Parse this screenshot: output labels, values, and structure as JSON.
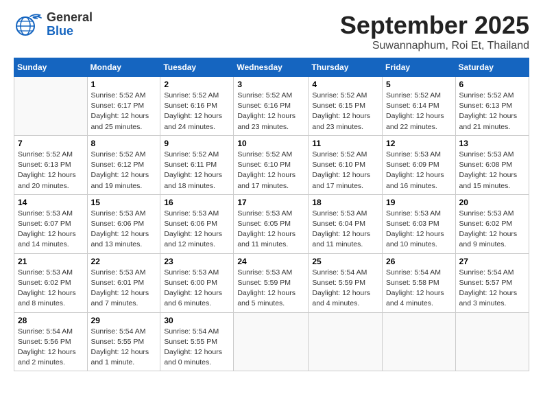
{
  "header": {
    "logo_line1": "General",
    "logo_line2": "Blue",
    "month": "September 2025",
    "location": "Suwannaphum, Roi Et, Thailand"
  },
  "weekdays": [
    "Sunday",
    "Monday",
    "Tuesday",
    "Wednesday",
    "Thursday",
    "Friday",
    "Saturday"
  ],
  "weeks": [
    [
      {
        "day": "",
        "info": ""
      },
      {
        "day": "1",
        "info": "Sunrise: 5:52 AM\nSunset: 6:17 PM\nDaylight: 12 hours\nand 25 minutes."
      },
      {
        "day": "2",
        "info": "Sunrise: 5:52 AM\nSunset: 6:16 PM\nDaylight: 12 hours\nand 24 minutes."
      },
      {
        "day": "3",
        "info": "Sunrise: 5:52 AM\nSunset: 6:16 PM\nDaylight: 12 hours\nand 23 minutes."
      },
      {
        "day": "4",
        "info": "Sunrise: 5:52 AM\nSunset: 6:15 PM\nDaylight: 12 hours\nand 23 minutes."
      },
      {
        "day": "5",
        "info": "Sunrise: 5:52 AM\nSunset: 6:14 PM\nDaylight: 12 hours\nand 22 minutes."
      },
      {
        "day": "6",
        "info": "Sunrise: 5:52 AM\nSunset: 6:13 PM\nDaylight: 12 hours\nand 21 minutes."
      }
    ],
    [
      {
        "day": "7",
        "info": "Sunrise: 5:52 AM\nSunset: 6:13 PM\nDaylight: 12 hours\nand 20 minutes."
      },
      {
        "day": "8",
        "info": "Sunrise: 5:52 AM\nSunset: 6:12 PM\nDaylight: 12 hours\nand 19 minutes."
      },
      {
        "day": "9",
        "info": "Sunrise: 5:52 AM\nSunset: 6:11 PM\nDaylight: 12 hours\nand 18 minutes."
      },
      {
        "day": "10",
        "info": "Sunrise: 5:52 AM\nSunset: 6:10 PM\nDaylight: 12 hours\nand 17 minutes."
      },
      {
        "day": "11",
        "info": "Sunrise: 5:52 AM\nSunset: 6:10 PM\nDaylight: 12 hours\nand 17 minutes."
      },
      {
        "day": "12",
        "info": "Sunrise: 5:53 AM\nSunset: 6:09 PM\nDaylight: 12 hours\nand 16 minutes."
      },
      {
        "day": "13",
        "info": "Sunrise: 5:53 AM\nSunset: 6:08 PM\nDaylight: 12 hours\nand 15 minutes."
      }
    ],
    [
      {
        "day": "14",
        "info": "Sunrise: 5:53 AM\nSunset: 6:07 PM\nDaylight: 12 hours\nand 14 minutes."
      },
      {
        "day": "15",
        "info": "Sunrise: 5:53 AM\nSunset: 6:06 PM\nDaylight: 12 hours\nand 13 minutes."
      },
      {
        "day": "16",
        "info": "Sunrise: 5:53 AM\nSunset: 6:06 PM\nDaylight: 12 hours\nand 12 minutes."
      },
      {
        "day": "17",
        "info": "Sunrise: 5:53 AM\nSunset: 6:05 PM\nDaylight: 12 hours\nand 11 minutes."
      },
      {
        "day": "18",
        "info": "Sunrise: 5:53 AM\nSunset: 6:04 PM\nDaylight: 12 hours\nand 11 minutes."
      },
      {
        "day": "19",
        "info": "Sunrise: 5:53 AM\nSunset: 6:03 PM\nDaylight: 12 hours\nand 10 minutes."
      },
      {
        "day": "20",
        "info": "Sunrise: 5:53 AM\nSunset: 6:02 PM\nDaylight: 12 hours\nand 9 minutes."
      }
    ],
    [
      {
        "day": "21",
        "info": "Sunrise: 5:53 AM\nSunset: 6:02 PM\nDaylight: 12 hours\nand 8 minutes."
      },
      {
        "day": "22",
        "info": "Sunrise: 5:53 AM\nSunset: 6:01 PM\nDaylight: 12 hours\nand 7 minutes."
      },
      {
        "day": "23",
        "info": "Sunrise: 5:53 AM\nSunset: 6:00 PM\nDaylight: 12 hours\nand 6 minutes."
      },
      {
        "day": "24",
        "info": "Sunrise: 5:53 AM\nSunset: 5:59 PM\nDaylight: 12 hours\nand 5 minutes."
      },
      {
        "day": "25",
        "info": "Sunrise: 5:54 AM\nSunset: 5:59 PM\nDaylight: 12 hours\nand 4 minutes."
      },
      {
        "day": "26",
        "info": "Sunrise: 5:54 AM\nSunset: 5:58 PM\nDaylight: 12 hours\nand 4 minutes."
      },
      {
        "day": "27",
        "info": "Sunrise: 5:54 AM\nSunset: 5:57 PM\nDaylight: 12 hours\nand 3 minutes."
      }
    ],
    [
      {
        "day": "28",
        "info": "Sunrise: 5:54 AM\nSunset: 5:56 PM\nDaylight: 12 hours\nand 2 minutes."
      },
      {
        "day": "29",
        "info": "Sunrise: 5:54 AM\nSunset: 5:55 PM\nDaylight: 12 hours\nand 1 minute."
      },
      {
        "day": "30",
        "info": "Sunrise: 5:54 AM\nSunset: 5:55 PM\nDaylight: 12 hours\nand 0 minutes."
      },
      {
        "day": "",
        "info": ""
      },
      {
        "day": "",
        "info": ""
      },
      {
        "day": "",
        "info": ""
      },
      {
        "day": "",
        "info": ""
      }
    ]
  ]
}
